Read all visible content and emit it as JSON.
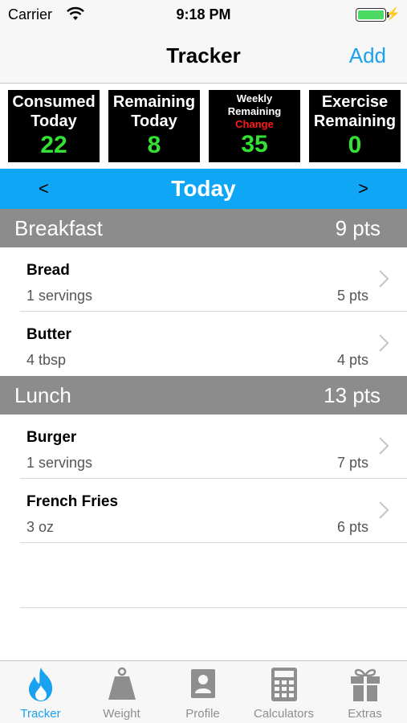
{
  "status_bar": {
    "carrier": "Carrier",
    "time": "9:18 PM",
    "wifi_icon": "wifi-icon",
    "battery_icon": "battery-icon",
    "charging_icon": "bolt-icon"
  },
  "nav": {
    "title": "Tracker",
    "add_label": "Add"
  },
  "stats": [
    {
      "line1": "Consumed",
      "line2": "Today",
      "value": "22"
    },
    {
      "line1": "Remaining",
      "line2": "Today",
      "value": "8"
    },
    {
      "line1": "Weekly",
      "line2": "Remaining",
      "extra": "Change",
      "value": "35"
    },
    {
      "line1": "Exercise",
      "line2": "Remaining",
      "value": "0"
    }
  ],
  "day_nav": {
    "prev": "<",
    "label": "Today",
    "next": ">"
  },
  "meals": [
    {
      "name": "Breakfast",
      "points": "9 pts",
      "items": [
        {
          "name": "Bread",
          "serving": "1 servings",
          "points": "5 pts"
        },
        {
          "name": "Butter",
          "serving": "4  tbsp",
          "points": "4 pts"
        }
      ]
    },
    {
      "name": "Lunch",
      "points": "13 pts",
      "items": [
        {
          "name": "Burger",
          "serving": "1 servings",
          "points": "7 pts"
        },
        {
          "name": "French Fries",
          "serving": "3 oz",
          "points": "6 pts"
        }
      ]
    }
  ],
  "tabs": [
    {
      "label": "Tracker",
      "icon": "flame-icon",
      "active": true
    },
    {
      "label": "Weight",
      "icon": "weight-icon",
      "active": false
    },
    {
      "label": "Profile",
      "icon": "profile-icon",
      "active": false
    },
    {
      "label": "Calculators",
      "icon": "calculator-icon",
      "active": false
    },
    {
      "label": "Extras",
      "icon": "gift-icon",
      "active": false
    }
  ],
  "colors": {
    "accent": "#1aa1f0",
    "day_bar": "#0fa6f5",
    "section_header": "#8c8c8c",
    "stat_value": "#33e333",
    "change": "#ff1a1a"
  }
}
